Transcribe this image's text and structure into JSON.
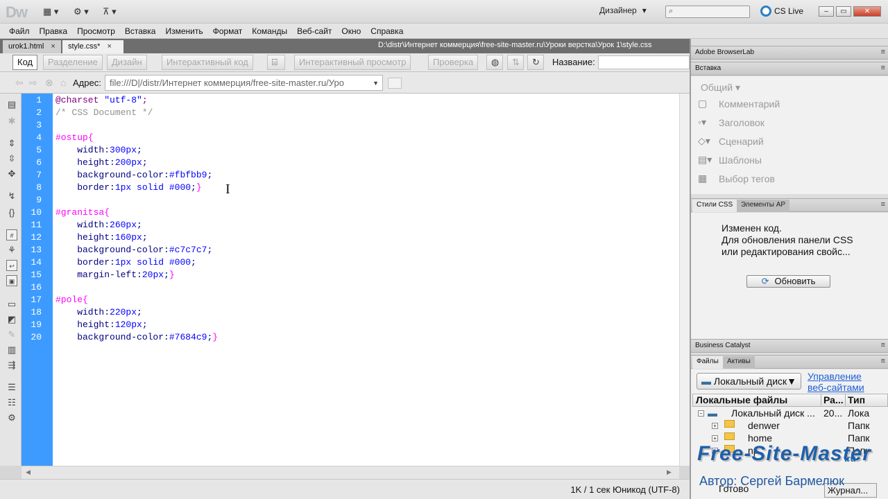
{
  "app": {
    "logo": "Dw",
    "workspace": "Дизайнер",
    "cs_live": "CS Live",
    "search_placeholder": "",
    "icons": [
      "layout-icon",
      "gear-icon",
      "site-icon"
    ]
  },
  "menu": [
    "Файл",
    "Правка",
    "Просмотр",
    "Вставка",
    "Изменить",
    "Формат",
    "Команды",
    "Веб-сайт",
    "Окно",
    "Справка"
  ],
  "tabs": [
    {
      "label": "urok1.html",
      "close": "×"
    },
    {
      "label": "style.css*",
      "close": "×"
    }
  ],
  "doc_path": "D:\\distr\\Интернет коммерция\\free-site-master.ru\\Уроки верстка\\Урок 1\\style.css",
  "toolbar": {
    "views": [
      "Код",
      "Разделение",
      "Дизайн",
      "Интерактивный код",
      "Интерактивный просмотр",
      "Проверка"
    ],
    "title_label": "Название:"
  },
  "address": {
    "label": "Адрес:",
    "value": "file:///D|/distr/Интернет коммерция/free-site-master.ru/Уро"
  },
  "line_numbers": [
    "1",
    "2",
    "3",
    "4",
    "5",
    "6",
    "7",
    "8",
    "9",
    "10",
    "11",
    "12",
    "13",
    "14",
    "15",
    "16",
    "17",
    "18",
    "19",
    "20"
  ],
  "code": [
    [
      {
        "t": "@charset ",
        "c": "at"
      },
      {
        "t": "\"utf-8\"",
        "c": "str"
      },
      {
        "t": ";",
        "c": "at"
      }
    ],
    [
      {
        "t": "/* CSS Document */",
        "c": "cmt"
      }
    ],
    [],
    [
      {
        "t": "#ostup",
        "c": "sel"
      },
      {
        "t": "{",
        "c": "br"
      }
    ],
    [
      {
        "t": "    width",
        "c": "prop"
      },
      {
        "t": ":",
        "c": "prop"
      },
      {
        "t": "300px",
        "c": "val"
      },
      {
        "t": ";",
        "c": "prop"
      }
    ],
    [
      {
        "t": "    height",
        "c": "prop"
      },
      {
        "t": ":",
        "c": "prop"
      },
      {
        "t": "200px",
        "c": "val"
      },
      {
        "t": ";",
        "c": "prop"
      }
    ],
    [
      {
        "t": "    background-color",
        "c": "prop"
      },
      {
        "t": ":",
        "c": "prop"
      },
      {
        "t": "#fbfbb9",
        "c": "val"
      },
      {
        "t": ";",
        "c": "prop"
      }
    ],
    [
      {
        "t": "    border",
        "c": "prop"
      },
      {
        "t": ":",
        "c": "prop"
      },
      {
        "t": "1px solid #000",
        "c": "val"
      },
      {
        "t": ";",
        "c": "prop"
      },
      {
        "t": "}",
        "c": "br"
      }
    ],
    [],
    [
      {
        "t": "#granitsa",
        "c": "sel"
      },
      {
        "t": "{",
        "c": "br"
      }
    ],
    [
      {
        "t": "    width",
        "c": "prop"
      },
      {
        "t": ":",
        "c": "prop"
      },
      {
        "t": "260px",
        "c": "val"
      },
      {
        "t": ";",
        "c": "prop"
      }
    ],
    [
      {
        "t": "    height",
        "c": "prop"
      },
      {
        "t": ":",
        "c": "prop"
      },
      {
        "t": "160px",
        "c": "val"
      },
      {
        "t": ";",
        "c": "prop"
      }
    ],
    [
      {
        "t": "    background-color",
        "c": "prop"
      },
      {
        "t": ":",
        "c": "prop"
      },
      {
        "t": "#c7c7c7",
        "c": "val"
      },
      {
        "t": ";",
        "c": "prop"
      }
    ],
    [
      {
        "t": "    border",
        "c": "prop"
      },
      {
        "t": ":",
        "c": "prop"
      },
      {
        "t": "1px solid #000",
        "c": "val"
      },
      {
        "t": ";",
        "c": "prop"
      }
    ],
    [
      {
        "t": "    margin-left",
        "c": "prop"
      },
      {
        "t": ":",
        "c": "prop"
      },
      {
        "t": "20px",
        "c": "val"
      },
      {
        "t": ";",
        "c": "prop"
      },
      {
        "t": "}",
        "c": "br"
      }
    ],
    [],
    [
      {
        "t": "#pole",
        "c": "sel"
      },
      {
        "t": "{",
        "c": "br"
      }
    ],
    [
      {
        "t": "    width",
        "c": "prop"
      },
      {
        "t": ":",
        "c": "prop"
      },
      {
        "t": "220px",
        "c": "val"
      },
      {
        "t": ";",
        "c": "prop"
      }
    ],
    [
      {
        "t": "    height",
        "c": "prop"
      },
      {
        "t": ":",
        "c": "prop"
      },
      {
        "t": "120px",
        "c": "val"
      },
      {
        "t": ";",
        "c": "prop"
      }
    ],
    [
      {
        "t": "    background-color",
        "c": "prop"
      },
      {
        "t": ":",
        "c": "prop"
      },
      {
        "t": "#7684c9",
        "c": "val"
      },
      {
        "t": ";",
        "c": "prop"
      },
      {
        "t": "}",
        "c": "br"
      }
    ]
  ],
  "status": {
    "text": "1K / 1 сек  Юникод (UTF-8)"
  },
  "panels": {
    "browserlab": "Adobe BrowserLab",
    "insert": {
      "title": "Вставка",
      "category": "Общий ▾",
      "items": [
        "Комментарий",
        "Заголовок",
        "Сценарий",
        "Шаблоны",
        "Выбор тегов"
      ]
    },
    "css": {
      "tab1": "Стили CSS",
      "tab2": "Элементы AP",
      "message": [
        "Изменен код.",
        "Для обновления панели CSS",
        "или редактирования свойс..."
      ],
      "refresh": "Обновить"
    },
    "catalyst": "Business Catalyst",
    "files": {
      "tab1": "Файлы",
      "tab2": "Активы",
      "disk": "Локальный диск",
      "manage": [
        "Управление",
        "веб-сайтами"
      ],
      "columns": [
        "Локальные файлы",
        "Ра...",
        "Тип"
      ],
      "rows": [
        {
          "name": "Локальный диск ...",
          "size": "20...",
          "type": "Лока"
        },
        {
          "name": "denwer",
          "size": "",
          "type": "Папк"
        },
        {
          "name": "home",
          "size": "",
          "type": "Папк"
        },
        {
          "name": "np",
          "size": "",
          "type": "Папк"
        }
      ],
      "ready": "Готово",
      "journal": "Журнал..."
    }
  },
  "watermark": {
    "site": "Free-Site-Master",
    "tld": ".ru",
    "author": "Автор: Сергей Бармелюк"
  },
  "colors": {
    "gutter": "#3d9bff",
    "selector": "#ff00ff",
    "property": "#000080",
    "value": "#0000ff"
  }
}
